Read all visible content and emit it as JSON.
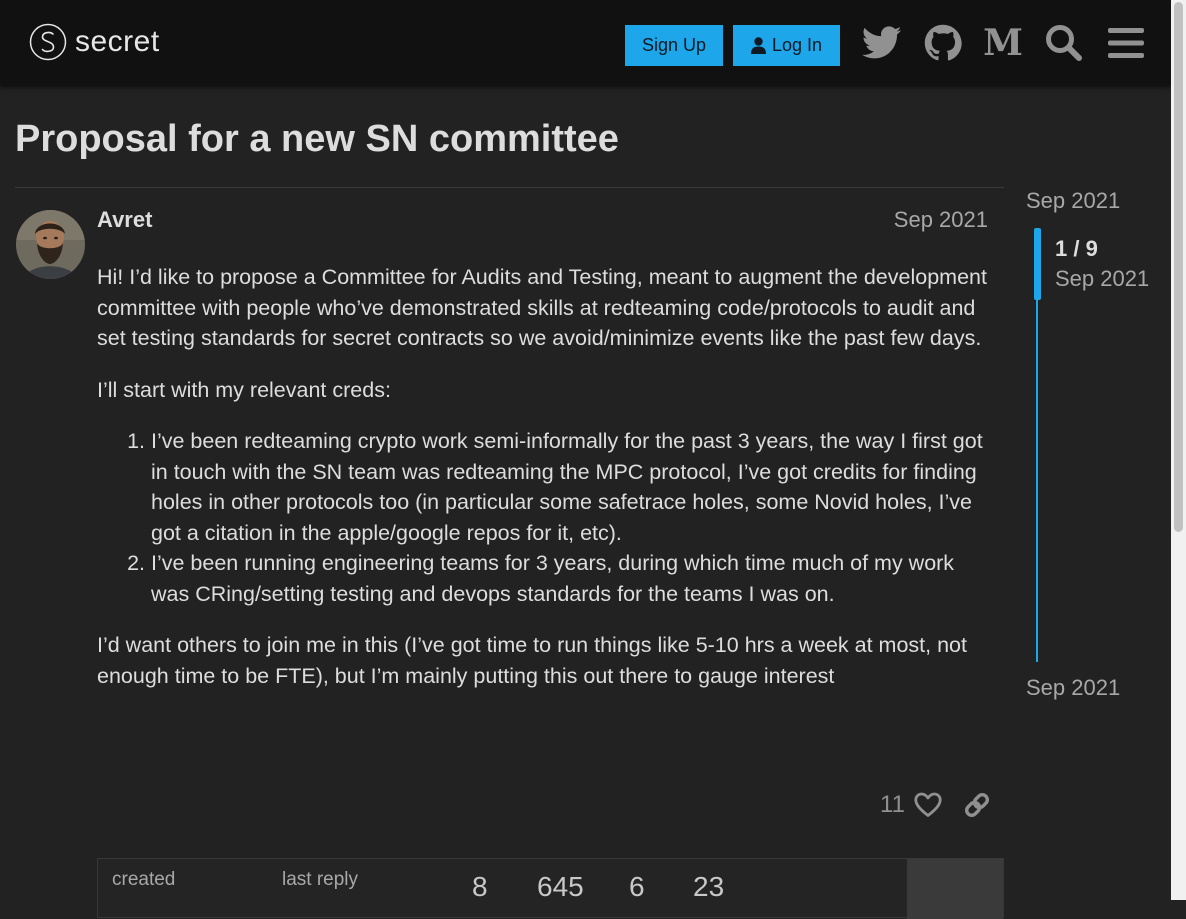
{
  "header": {
    "logo_text": "secret",
    "signup_label": "Sign Up",
    "login_label": "Log In",
    "icons": [
      "twitter-icon",
      "github-icon",
      "medium-icon",
      "search-icon",
      "hamburger-menu-icon"
    ],
    "accent_color": "#1da6ea"
  },
  "topic": {
    "title": "Proposal for a new SN committee"
  },
  "post": {
    "username": "Avret",
    "date": "Sep 2021",
    "paragraph1": "Hi! I’d like to propose a Committee for Audits and Testing, meant to augment the development committee with people who’ve demonstrated skills at redteaming code/protocols to audit and set testing standards for secret contracts so we avoid/minimize events like the past few days.",
    "paragraph2": "I’ll start with my relevant creds:",
    "list": [
      "I’ve been redteaming crypto work semi-informally for the past 3 years, the way I first got in touch with the SN team was redteaming the MPC protocol, I’ve got credits for finding holes in other protocols too (in particular some safetrace holes, some Novid holes, I’ve got a citation in the apple/google repos for it, etc).",
      "I’ve been running engineering teams for 3 years, during which time much of my work was CRing/setting testing and devops standards for the teams I was on."
    ],
    "paragraph3": "I’d want others to join me in this (I’ve got time to run things like 5-10 hrs a week at most, not enough time to be FTE), but I’m mainly putting this out there to gauge interest",
    "like_count": "11"
  },
  "topic_map": {
    "created_label": "created",
    "last_reply_label": "last reply",
    "replies": "8",
    "views": "645",
    "users": "6",
    "likes": "23"
  },
  "timeline": {
    "start_date": "Sep 2021",
    "position": "1 / 9",
    "position_date": "Sep 2021",
    "end_date": "Sep 2021"
  }
}
